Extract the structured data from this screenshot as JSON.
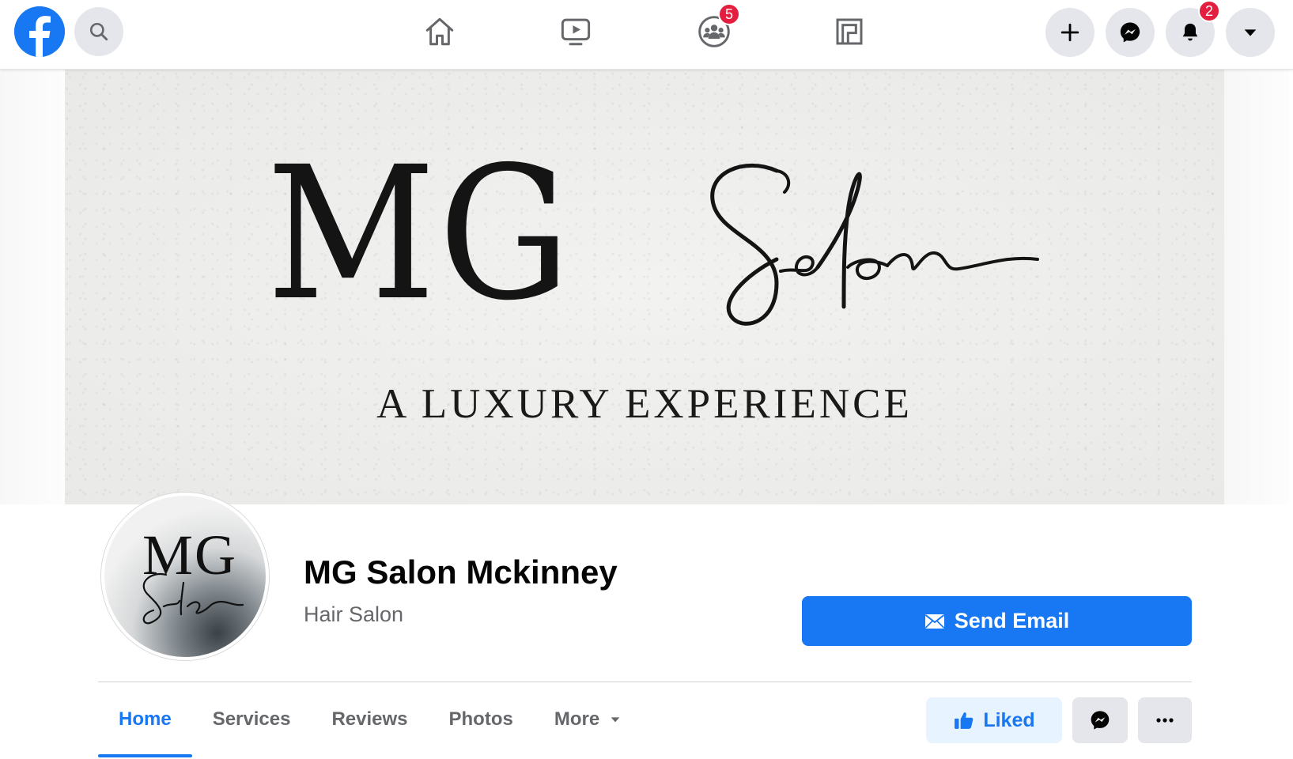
{
  "topbar": {
    "logo": "facebook-logo",
    "search_icon": "search-icon",
    "nav_items": [
      {
        "name": "home",
        "icon": "home-icon"
      },
      {
        "name": "watch",
        "icon": "video-play-icon"
      },
      {
        "name": "groups",
        "icon": "groups-icon",
        "badge": "5"
      },
      {
        "name": "pages",
        "icon": "pages-icon"
      }
    ],
    "right_buttons": [
      {
        "name": "create",
        "icon": "plus-icon"
      },
      {
        "name": "messenger",
        "icon": "messenger-icon"
      },
      {
        "name": "notifications",
        "icon": "bell-icon",
        "badge": "2"
      },
      {
        "name": "account",
        "icon": "caret-down-icon"
      }
    ]
  },
  "cover": {
    "logo_main": "MG",
    "logo_script": "Salon",
    "tagline": "A LUXURY EXPERIENCE"
  },
  "profile": {
    "avatar_text": "MG",
    "avatar_script": "Salon",
    "name": "MG Salon Mckinney",
    "category": "Hair Salon",
    "primary_action": "Send Email"
  },
  "tabs": [
    {
      "label": "Home",
      "active": true
    },
    {
      "label": "Services",
      "active": false
    },
    {
      "label": "Reviews",
      "active": false
    },
    {
      "label": "Photos",
      "active": false
    },
    {
      "label": "More",
      "active": false
    }
  ],
  "actions": {
    "liked_label": "Liked"
  },
  "colors": {
    "brand_blue": "#1877f2",
    "badge_red": "#e41e3f",
    "button_gray": "#e4e6eb",
    "liked_bg": "#e7f3ff",
    "secondary_text": "#65676b"
  }
}
